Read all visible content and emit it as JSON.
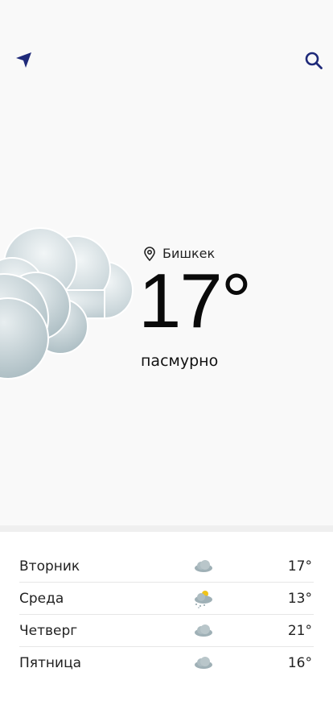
{
  "header": {
    "locate_icon": "location-arrow-icon",
    "search_icon": "search-icon"
  },
  "current": {
    "city": "Бишкек",
    "city_icon": "map-pin-icon",
    "temperature": "17°",
    "condition": "пасмурно",
    "condition_icon": "overcast-cloud-icon"
  },
  "colors": {
    "accent": "#1f2a7a",
    "top_background": "#f9f9f9"
  },
  "forecast": [
    {
      "day": "Вторник",
      "icon": "cloud-icon",
      "temp": "17°"
    },
    {
      "day": "Среда",
      "icon": "cloud-sun-rain-icon",
      "temp": "13°"
    },
    {
      "day": "Четверг",
      "icon": "cloud-icon",
      "temp": "21°"
    },
    {
      "day": "Пятница",
      "icon": "cloud-icon",
      "temp": "16°"
    }
  ]
}
